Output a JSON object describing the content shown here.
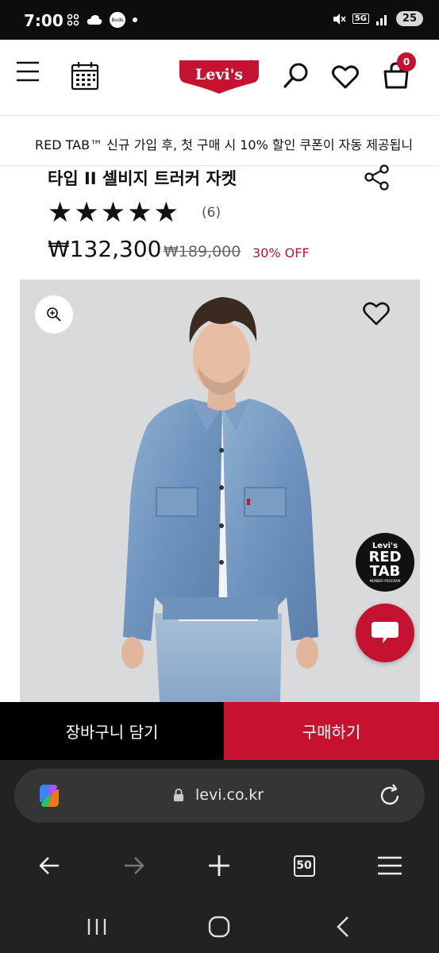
{
  "status_bar": {
    "time": "7:00",
    "buds_label": "Buds",
    "network": "5G",
    "battery": "25"
  },
  "header": {
    "logo_text": "Levi's",
    "logo_mark": "®",
    "cart_count": "0",
    "brand_color": "#c41230"
  },
  "promo": {
    "text": "RED TAB™ 신규 가입 후, 첫 구매 시 10% 할인 쿠폰이 자동 제공됩니"
  },
  "product": {
    "title": "타입 II 셀비지 트러커 자켓",
    "rating_stars": 5,
    "review_count": "(6)",
    "price": "₩132,300",
    "original_price": "₩189,000",
    "discount": "30% OFF"
  },
  "badges": {
    "redtab_brand": "Levi's",
    "redtab_line1": "RED",
    "redtab_line2": "TAB",
    "redtab_sub": "MEMBER PROGRAM"
  },
  "actions": {
    "add_to_cart": "장바구니 담기",
    "buy_now": "구매하기"
  },
  "browser": {
    "url": "levi.co.kr",
    "tab_count": "50"
  }
}
